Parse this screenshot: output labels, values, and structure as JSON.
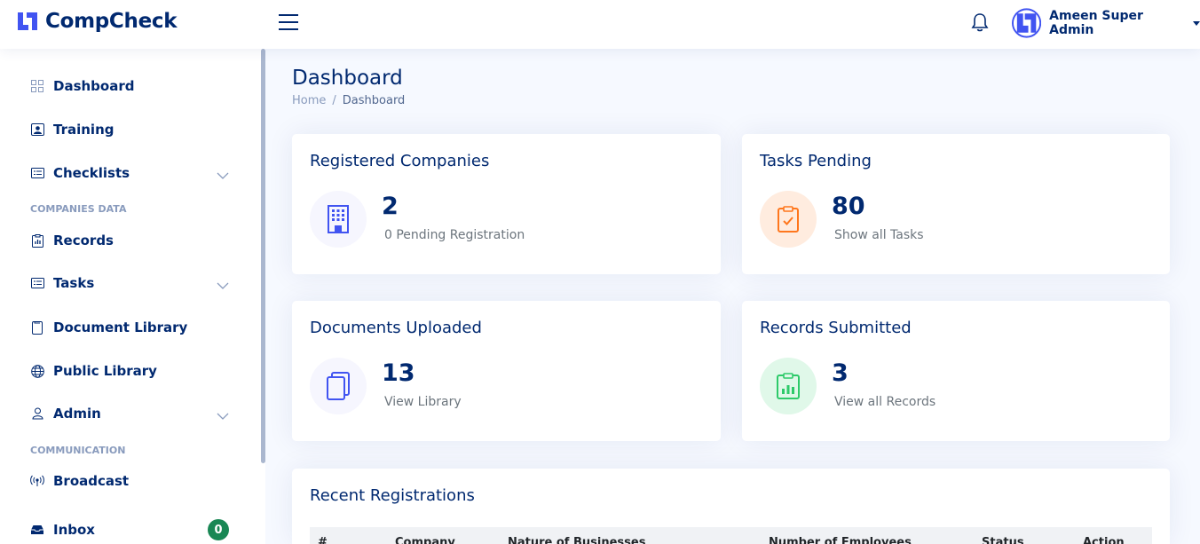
{
  "header": {
    "brand": "CompCheck",
    "user_name": "Ameen Super Admin"
  },
  "colors": {
    "primary": "#012970",
    "accent": "#4154f1",
    "orange": "#ff771d",
    "green": "#2eca6a",
    "badge_green": "#198754"
  },
  "sidebar": {
    "items": [
      {
        "label": "Dashboard",
        "icon": "grid-icon"
      },
      {
        "label": "Training",
        "icon": "person-video-icon"
      },
      {
        "label": "Checklists",
        "icon": "card-list-icon"
      },
      {
        "heading": "COMPANIES DATA"
      },
      {
        "label": "Records",
        "icon": "clipboard-data-icon"
      },
      {
        "label": "Tasks",
        "icon": "card-list-icon"
      },
      {
        "label": "Document Library",
        "icon": "file-icon"
      },
      {
        "label": "Public Library",
        "icon": "globe-icon"
      },
      {
        "label": "Admin",
        "icon": "person-icon"
      },
      {
        "heading": "COMMUNICATION"
      },
      {
        "label": "Broadcast",
        "icon": "broadcast-icon"
      },
      {
        "label": "Inbox",
        "icon": "inbox-icon",
        "badge": "0"
      }
    ]
  },
  "main": {
    "title": "Dashboard",
    "breadcrumb": {
      "home": "Home",
      "separator": "/",
      "current": "Dashboard"
    },
    "cards": [
      {
        "title": "Registered Companies",
        "value": "2",
        "sub": "0 Pending Registration",
        "icon": "building-icon"
      },
      {
        "title": "Tasks Pending",
        "value": "80",
        "sub": "Show all Tasks",
        "icon": "clipboard-check-icon"
      },
      {
        "title": "Documents Uploaded",
        "value": "13",
        "sub": "View Library",
        "icon": "files-icon"
      },
      {
        "title": "Records Submitted",
        "value": "3",
        "sub": "View all Records",
        "icon": "clipboard-data-icon"
      }
    ],
    "recent": {
      "title": "Recent Registrations",
      "columns": [
        "#",
        "Company",
        "Nature of Businesses",
        "Number of Employees",
        "Status",
        "Action"
      ]
    }
  }
}
